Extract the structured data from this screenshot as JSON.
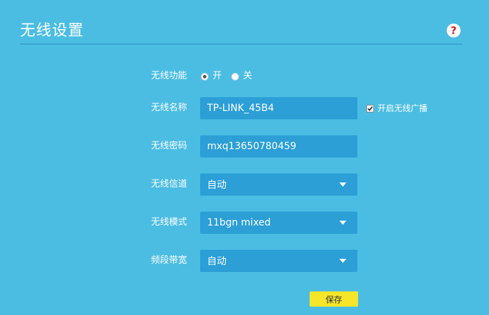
{
  "page": {
    "title": "无线设置",
    "help_icon": "question-icon",
    "colors": {
      "background": "#4bbde3",
      "field": "#2b9fd6",
      "save_button": "#f5e62a"
    }
  },
  "form": {
    "wireless_function": {
      "label": "无线功能",
      "options": [
        {
          "label": "开",
          "selected": true
        },
        {
          "label": "关",
          "selected": false
        }
      ]
    },
    "ssid": {
      "label": "无线名称",
      "value": "TP-LINK_45B4",
      "broadcast_label": "开启无线广播",
      "broadcast_checked": true
    },
    "password": {
      "label": "无线密码",
      "value": "mxq13650780459"
    },
    "channel": {
      "label": "无线信道",
      "value": "自动"
    },
    "mode": {
      "label": "无线模式",
      "value": "11bgn mixed"
    },
    "bandwidth": {
      "label": "频段带宽",
      "value": "自动"
    }
  },
  "actions": {
    "save_label": "保存"
  }
}
